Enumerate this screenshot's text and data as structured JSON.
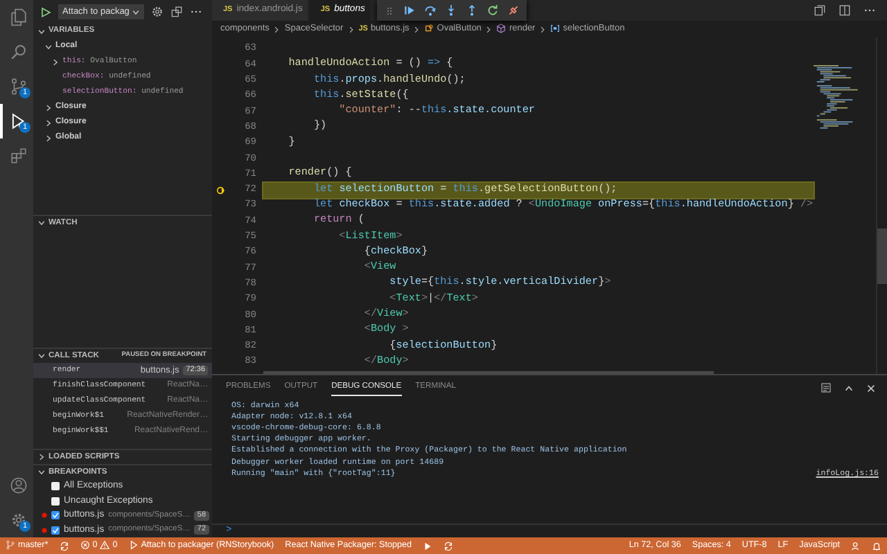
{
  "activity_bar": [
    {
      "kind": "explorer",
      "selected": false
    },
    {
      "kind": "search",
      "selected": false
    },
    {
      "kind": "source-control",
      "selected": false,
      "badge": "1"
    },
    {
      "kind": "debug",
      "selected": true,
      "badge": "1"
    },
    {
      "kind": "extensions",
      "selected": false
    },
    {
      "kind": "accounts",
      "selected": false
    },
    {
      "kind": "manage",
      "selected": false,
      "badge": "1"
    }
  ],
  "debug_sidebar": {
    "configuration": "Attach to packag",
    "variables": {
      "title": "VARIABLES",
      "expanded": true,
      "scopes": [
        {
          "label": "Local",
          "expanded": true,
          "children": [
            {
              "name": "this:",
              "value": "OvalButton",
              "expanded": false
            },
            {
              "name": "checkBox:",
              "value": "undefined"
            },
            {
              "name": "selectionButton:",
              "value": "undefined"
            }
          ]
        },
        {
          "label": "Closure",
          "expanded": false
        },
        {
          "label": "Closure",
          "expanded": false
        },
        {
          "label": "Global",
          "expanded": false
        }
      ]
    },
    "watch": {
      "title": "WATCH",
      "expanded": true
    },
    "call_stack": {
      "title": "CALL STACK",
      "status": "PAUSED ON BREAKPOINT",
      "expanded": true,
      "frames": [
        {
          "name": "render",
          "file": "buttons.js",
          "position": "72:36",
          "selected": true
        },
        {
          "name": "finishClassComponent",
          "file": "ReactNa…",
          "selected": false
        },
        {
          "name": "updateClassComponent",
          "file": "ReactNa…",
          "selected": false
        },
        {
          "name": "beginWork$1",
          "file": "ReactNativeRender…",
          "selected": false
        },
        {
          "name": "beginWork$$1",
          "file": "ReactNativeRend…",
          "selected": false
        }
      ]
    },
    "loaded_scripts": {
      "title": "LOADED SCRIPTS",
      "expanded": false
    },
    "breakpoints": {
      "title": "BREAKPOINTS",
      "expanded": true,
      "items": [
        {
          "kind": "exception",
          "label": "All Exceptions",
          "checked": false
        },
        {
          "kind": "exception",
          "label": "Uncaught Exceptions",
          "checked": false
        },
        {
          "kind": "line",
          "label": "buttons.js",
          "path": "components/SpaceS…",
          "line": "58",
          "checked": true
        },
        {
          "kind": "line",
          "label": "buttons.js",
          "path": "components/SpaceS…",
          "line": "72",
          "checked": true
        }
      ]
    }
  },
  "editor": {
    "tabs": [
      {
        "file_icon": "JS",
        "label": "index.android.js",
        "selected": false
      },
      {
        "file_icon": "JS",
        "label": "buttons",
        "selected": true
      }
    ],
    "breadcrumbs": [
      {
        "kind": "folder",
        "text": "components"
      },
      {
        "kind": "folder",
        "text": "SpaceSelector"
      },
      {
        "kind": "file",
        "file_icon": "JS",
        "text": "buttons.js"
      },
      {
        "kind": "class",
        "text": "OvalButton"
      },
      {
        "kind": "method",
        "text": "render"
      },
      {
        "kind": "variable",
        "text": "selectionButton"
      }
    ],
    "lines": [
      {
        "number": "63"
      },
      {
        "number": "64",
        "tokens": [
          {
            "text": "    handleUndoAction",
            "kind": "function"
          },
          {
            "text": " = () ",
            "kind": "plain"
          },
          {
            "text": "=>",
            "kind": "keyword"
          },
          {
            "text": " {",
            "kind": "plain"
          }
        ]
      },
      {
        "number": "65",
        "tokens": [
          {
            "text": "        this",
            "kind": "keyword"
          },
          {
            "text": ".",
            "kind": "plain"
          },
          {
            "text": "props",
            "kind": "variable"
          },
          {
            "text": ".",
            "kind": "plain"
          },
          {
            "text": "handleUndo",
            "kind": "function"
          },
          {
            "text": "();",
            "kind": "plain"
          }
        ]
      },
      {
        "number": "66",
        "tokens": [
          {
            "text": "        this",
            "kind": "keyword"
          },
          {
            "text": ".",
            "kind": "plain"
          },
          {
            "text": "setState",
            "kind": "function"
          },
          {
            "text": "({",
            "kind": "plain"
          }
        ]
      },
      {
        "number": "67",
        "tokens": [
          {
            "text": "            \"counter\"",
            "kind": "string"
          },
          {
            "text": ": --",
            "kind": "plain"
          },
          {
            "text": "this",
            "kind": "keyword"
          },
          {
            "text": ".state.counter",
            "kind": "variable"
          }
        ]
      },
      {
        "number": "68",
        "tokens": [
          {
            "text": "        })",
            "kind": "plain"
          }
        ]
      },
      {
        "number": "69",
        "tokens": [
          {
            "text": "    }",
            "kind": "plain"
          }
        ]
      },
      {
        "number": "70"
      },
      {
        "number": "71",
        "tokens": [
          {
            "text": "    render",
            "kind": "function"
          },
          {
            "text": "() {",
            "kind": "plain"
          }
        ]
      },
      {
        "number": "72",
        "current": true,
        "tokens": [
          {
            "text": "        let",
            "kind": "keyword"
          },
          {
            "text": " selectionButton",
            "kind": "variable"
          },
          {
            "text": " = ",
            "kind": "plain"
          },
          {
            "text": "this",
            "kind": "keyword"
          },
          {
            "text": ".",
            "kind": "plain"
          },
          {
            "text": "getSelectionButton",
            "kind": "function"
          },
          {
            "text": "();",
            "kind": "plain"
          }
        ]
      },
      {
        "number": "73",
        "tokens": [
          {
            "text": "        let",
            "kind": "keyword"
          },
          {
            "text": " checkBox",
            "kind": "variable"
          },
          {
            "text": " = ",
            "kind": "plain"
          },
          {
            "text": "this",
            "kind": "keyword"
          },
          {
            "text": ".state.added",
            "kind": "variable"
          },
          {
            "text": " ? ",
            "kind": "plain"
          },
          {
            "text": "<",
            "kind": "bracket"
          },
          {
            "text": "UndoImage",
            "kind": "tag"
          },
          {
            "text": " onPress",
            "kind": "variable"
          },
          {
            "text": "={",
            "kind": "plain"
          },
          {
            "text": "this",
            "kind": "keyword"
          },
          {
            "text": ".handleUndoAction",
            "kind": "variable"
          },
          {
            "text": "} ",
            "kind": "plain"
          },
          {
            "text": "/>",
            "kind": "bracket"
          }
        ]
      },
      {
        "number": "74",
        "tokens": [
          {
            "text": "        return",
            "kind": "control"
          },
          {
            "text": " (",
            "kind": "plain"
          }
        ]
      },
      {
        "number": "75",
        "tokens": [
          {
            "text": "            <",
            "kind": "bracket"
          },
          {
            "text": "ListItem",
            "kind": "tag"
          },
          {
            "text": ">",
            "kind": "bracket"
          }
        ]
      },
      {
        "number": "76",
        "tokens": [
          {
            "text": "                {",
            "kind": "plain"
          },
          {
            "text": "checkBox",
            "kind": "variable"
          },
          {
            "text": "}",
            "kind": "plain"
          }
        ]
      },
      {
        "number": "77",
        "tokens": [
          {
            "text": "                <",
            "kind": "bracket"
          },
          {
            "text": "View",
            "kind": "tag"
          }
        ]
      },
      {
        "number": "78",
        "tokens": [
          {
            "text": "                    style",
            "kind": "variable"
          },
          {
            "text": "={",
            "kind": "plain"
          },
          {
            "text": "this",
            "kind": "keyword"
          },
          {
            "text": ".style.verticalDivider",
            "kind": "variable"
          },
          {
            "text": "}",
            "kind": "plain"
          },
          {
            "text": ">",
            "kind": "bracket"
          }
        ]
      },
      {
        "number": "79",
        "tokens": [
          {
            "text": "                    <",
            "kind": "bracket"
          },
          {
            "text": "Text",
            "kind": "tag"
          },
          {
            "text": ">",
            "kind": "bracket"
          },
          {
            "text": "|",
            "kind": "plain"
          },
          {
            "text": "</",
            "kind": "bracket"
          },
          {
            "text": "Text",
            "kind": "tag"
          },
          {
            "text": ">",
            "kind": "bracket"
          }
        ]
      },
      {
        "number": "80",
        "tokens": [
          {
            "text": "                </",
            "kind": "bracket"
          },
          {
            "text": "View",
            "kind": "tag"
          },
          {
            "text": ">",
            "kind": "bracket"
          }
        ]
      },
      {
        "number": "81",
        "tokens": [
          {
            "text": "                <",
            "kind": "bracket"
          },
          {
            "text": "Body",
            "kind": "tag"
          },
          {
            "text": " >",
            "kind": "bracket"
          }
        ]
      },
      {
        "number": "82",
        "tokens": [
          {
            "text": "                    {",
            "kind": "plain"
          },
          {
            "text": "selectionButton",
            "kind": "variable"
          },
          {
            "text": "}",
            "kind": "plain"
          }
        ]
      },
      {
        "number": "83",
        "tokens": [
          {
            "text": "                </",
            "kind": "bracket"
          },
          {
            "text": "Body",
            "kind": "tag"
          },
          {
            "text": ">",
            "kind": "bracket"
          }
        ]
      }
    ]
  },
  "panel": {
    "tabs": [
      {
        "label": "PROBLEMS",
        "selected": false
      },
      {
        "label": "OUTPUT",
        "selected": false
      },
      {
        "label": "DEBUG CONSOLE",
        "selected": true
      },
      {
        "label": "TERMINAL",
        "selected": false
      }
    ],
    "console": [
      {
        "text": "OS: darwin x64"
      },
      {
        "text": "Adapter node: v12.8.1 x64"
      },
      {
        "text": "vscode-chrome-debug-core: 6.8.8"
      },
      {
        "text": "Starting debugger app worker."
      },
      {
        "text": "Established a connection with the Proxy (Packager) to the React Native application"
      },
      {
        "text": "Debugger worker loaded runtime on port 14689"
      },
      {
        "text": "Running \"main\" with {\"rootTag\":11}",
        "source": "infoLog.js:16"
      }
    ],
    "prompt": ">"
  },
  "status_bar": {
    "left": [
      {
        "kind": "branch",
        "text": "master*"
      },
      {
        "kind": "sync"
      },
      {
        "kind": "problems",
        "errors": "0",
        "warnings": "0"
      },
      {
        "kind": "debug",
        "text": "Attach to packager (RNStorybook)"
      },
      {
        "kind": "text",
        "text": "React Native Packager: Stopped"
      },
      {
        "kind": "play"
      },
      {
        "kind": "sync"
      }
    ],
    "right": [
      {
        "kind": "text",
        "text": "Ln 72, Col 36"
      },
      {
        "kind": "text",
        "text": "Spaces: 4"
      },
      {
        "kind": "text",
        "text": "UTF-8"
      },
      {
        "kind": "text",
        "text": "LF"
      },
      {
        "kind": "text",
        "text": "JavaScript"
      },
      {
        "kind": "feedback"
      },
      {
        "kind": "bell"
      }
    ]
  }
}
